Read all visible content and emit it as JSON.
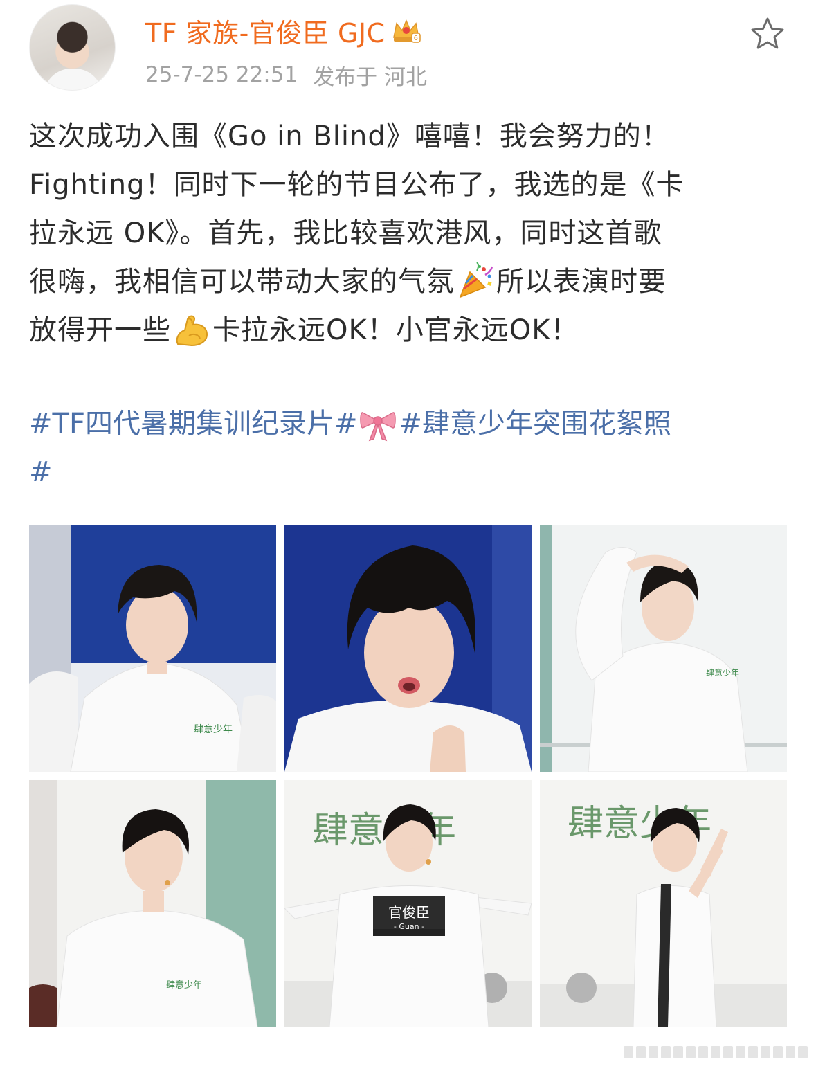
{
  "post": {
    "author": "TF 家族-官俊臣 GJC",
    "timestamp": "25-7-25 22:51",
    "location": "发布于 河北",
    "text_lines": [
      "这次成功入围《Go in Blind》嘻嘻！我会努力的！",
      "Fighting！同时下一轮的节目公布了，我选的是《卡",
      "拉永远 OK》。首先，我比较喜欢港风，同时这首歌",
      "很嗨，我相信可以带动大家的气氛",
      "所以表演时要",
      "放得开一些",
      "卡拉永远OK！小官永远OK！"
    ],
    "tags": {
      "tag1": "#TF四代暑期集训纪录片#",
      "tag2": "#肆意少年突围花絮照",
      "tag3": "#"
    },
    "photos": [
      {
        "name": "photo-1"
      },
      {
        "name": "photo-2"
      },
      {
        "name": "photo-3"
      },
      {
        "name": "photo-4"
      },
      {
        "name": "photo-5"
      },
      {
        "name": "photo-6"
      }
    ],
    "photo_text": {
      "shirt_logo": "肆意少年",
      "banner": "肆意少年",
      "name_tag": "官俊臣",
      "name_tag_sub": "- Guan -"
    }
  },
  "icons": {
    "vip": "crown-badge-icon",
    "follow": "star-outline-icon",
    "party": "party-popper-icon",
    "muscle": "flexed-biceps-icon",
    "bow": "ribbon-bow-icon"
  },
  "colors": {
    "author": "#f06b1f",
    "meta": "#a2a2a2",
    "text": "#2c2c2c",
    "tag": "#4b6fa8"
  }
}
